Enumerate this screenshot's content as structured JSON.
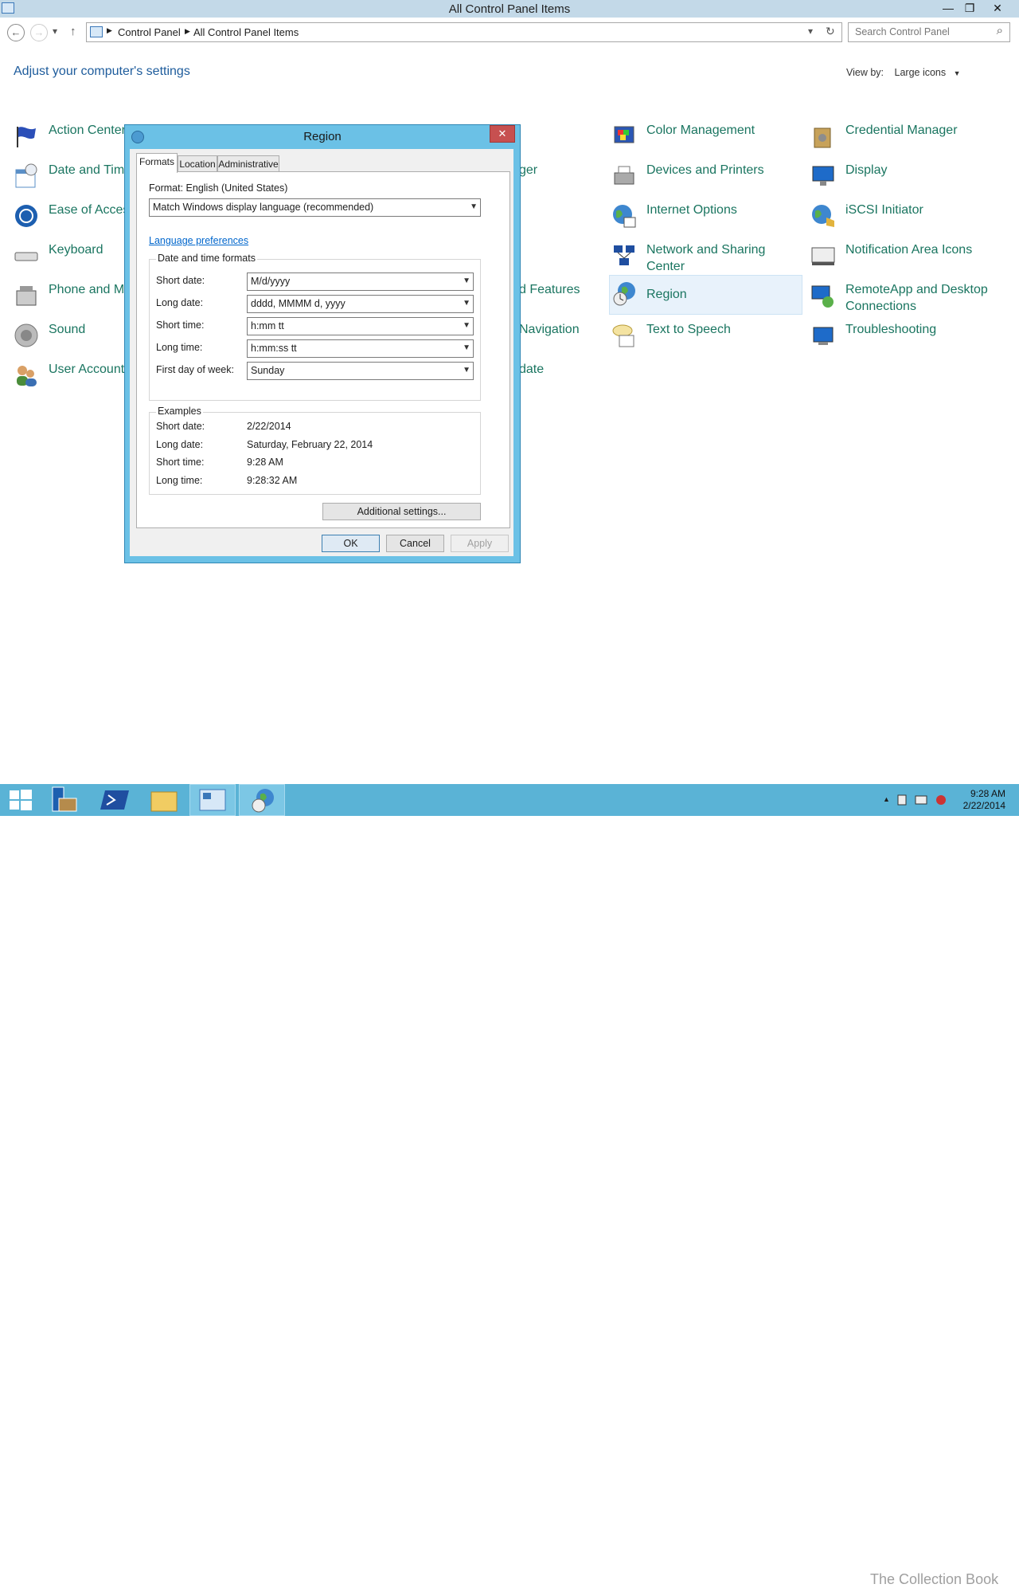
{
  "window": {
    "title": "All Control Panel Items",
    "minimize": "—",
    "restore": "❐",
    "close": "✕"
  },
  "navbar": {
    "back": "←",
    "forward": "→",
    "recent": "▾",
    "up": "↑",
    "breadcrumb": [
      "Control Panel",
      "All Control Panel Items"
    ],
    "search_placeholder": "Search Control Panel",
    "dropdown": "▾",
    "refresh": "↻",
    "search_icon": "⌕"
  },
  "page": {
    "heading": "Adjust your computer's settings",
    "view_by_label": "View by:",
    "view_by_value": "Large icons",
    "view_by_arrow": "▼"
  },
  "items": [
    {
      "label": "Action Center",
      "icon": "flag-icon"
    },
    {
      "label": "Date and Time",
      "icon": "calendar-clock-icon"
    },
    {
      "label": "Ease of Access",
      "icon": "ease-of-access-icon"
    },
    {
      "label": "Keyboard",
      "icon": "keyboard-icon"
    },
    {
      "label": "Phone and Modem",
      "icon": "phone-icon"
    },
    {
      "label": "Sound",
      "icon": "speaker-icon"
    },
    {
      "label": "User Accounts",
      "icon": "users-icon"
    },
    {
      "label": "ger",
      "icon": ""
    },
    {
      "label": "d Features",
      "icon": ""
    },
    {
      "label": "Navigation",
      "icon": ""
    },
    {
      "label": "date",
      "icon": ""
    },
    {
      "label": "Color Management",
      "icon": "color-management-icon"
    },
    {
      "label": "Devices and Printers",
      "icon": "printer-icon"
    },
    {
      "label": "Internet Options",
      "icon": "globe-icon"
    },
    {
      "label": "Network and Sharing Center",
      "icon": "network-icon"
    },
    {
      "label": "Region",
      "icon": "region-icon"
    },
    {
      "label": "Text to Speech",
      "icon": "speech-icon"
    },
    {
      "label": "Credential Manager",
      "icon": "credential-icon"
    },
    {
      "label": "Display",
      "icon": "monitor-icon"
    },
    {
      "label": "iSCSI Initiator",
      "icon": "iscsi-icon"
    },
    {
      "label": "Notification Area Icons",
      "icon": "notification-icon"
    },
    {
      "label": "RemoteApp and Desktop Connections",
      "icon": "remoteapp-icon"
    },
    {
      "label": "Troubleshooting",
      "icon": "troubleshooting-icon"
    }
  ],
  "dialog": {
    "title": "Region",
    "close": "✕",
    "tabs": [
      "Formats",
      "Location",
      "Administrative"
    ],
    "format_label": "Format: English (United States)",
    "format_value": "Match Windows display language (recommended)",
    "language_link": "Language preferences",
    "dt_group": "Date and time formats",
    "fields": [
      {
        "label": "Short date:",
        "value": "M/d/yyyy"
      },
      {
        "label": "Long date:",
        "value": "dddd, MMMM d, yyyy"
      },
      {
        "label": "Short time:",
        "value": "h:mm tt"
      },
      {
        "label": "Long time:",
        "value": "h:mm:ss tt"
      },
      {
        "label": "First day of week:",
        "value": "Sunday"
      }
    ],
    "examples_group": "Examples",
    "examples": [
      {
        "label": "Short date:",
        "value": "2/22/2014"
      },
      {
        "label": "Long date:",
        "value": "Saturday, February 22, 2014"
      },
      {
        "label": "Short time:",
        "value": "9:28 AM"
      },
      {
        "label": "Long time:",
        "value": "9:28:32 AM"
      }
    ],
    "additional": "Additional settings...",
    "ok": "OK",
    "cancel": "Cancel",
    "apply": "Apply",
    "arrow": "▼"
  },
  "taskbar": {
    "clock_time": "9:28 AM",
    "clock_date": "2/22/2014",
    "tray_arrow": "▲",
    "watermark": "The Collection Book"
  },
  "colors": {
    "accent": "#1a7560",
    "heading": "#1e5c9c",
    "dialog_frame": "#6bc1e6",
    "taskbar": "#5ab3d6"
  }
}
